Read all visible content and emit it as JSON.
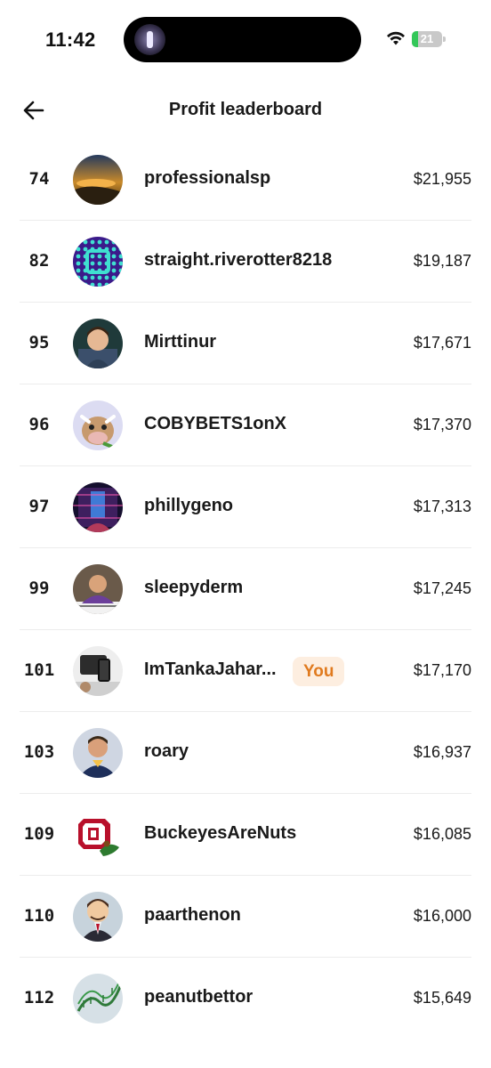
{
  "status_bar": {
    "time": "11:42",
    "battery_level": "21",
    "battery_fraction": 0.21
  },
  "header": {
    "title": "Profit leaderboard",
    "back_icon": "arrow-left-icon"
  },
  "colors": {
    "you_badge_bg": "#fdeee0",
    "you_badge_text": "#e07a1e",
    "divider": "#ececec",
    "battery_green": "#34c759"
  },
  "leaderboard": [
    {
      "rank": "74",
      "username": "professionalsp",
      "profit": "$21,955",
      "is_you": false
    },
    {
      "rank": "82",
      "username": "straight.riverotter8218",
      "profit": "$19,187",
      "is_you": false
    },
    {
      "rank": "95",
      "username": "Mirttinur",
      "profit": "$17,671",
      "is_you": false
    },
    {
      "rank": "96",
      "username": "COBYBETS1onX",
      "profit": "$17,370",
      "is_you": false
    },
    {
      "rank": "97",
      "username": "phillygeno",
      "profit": "$17,313",
      "is_you": false
    },
    {
      "rank": "99",
      "username": "sleepyderm",
      "profit": "$17,245",
      "is_you": false
    },
    {
      "rank": "101",
      "username": "ImTankaJahar...",
      "profit": "$17,170",
      "is_you": true,
      "badge": "You"
    },
    {
      "rank": "103",
      "username": "roary",
      "profit": "$16,937",
      "is_you": false
    },
    {
      "rank": "109",
      "username": "BuckeyesAreNuts",
      "profit": "$16,085",
      "is_you": false
    },
    {
      "rank": "110",
      "username": "paarthenon",
      "profit": "$16,000",
      "is_you": false
    },
    {
      "rank": "112",
      "username": "peanutbettor",
      "profit": "$15,649",
      "is_you": false
    }
  ]
}
